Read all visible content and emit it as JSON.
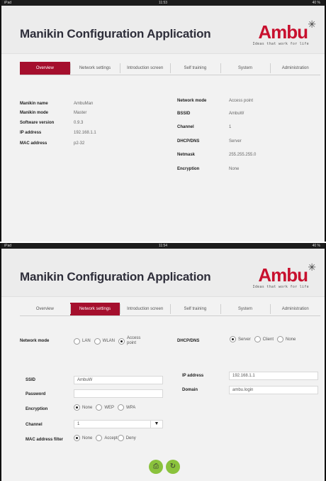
{
  "screen1": {
    "status": {
      "left": "iPad",
      "time": "11:53",
      "right": "40 %"
    },
    "title": "Manikin Configuration Application",
    "logo": {
      "word": "Ambu",
      "tagline": "Ideas that work for life"
    },
    "tabs": [
      "Overview",
      "Network settings",
      "Introduction screen",
      "Self training",
      "System",
      "Administration"
    ],
    "active_tab": 0,
    "left_info": [
      {
        "label": "Manikin name",
        "value": "AmbuMan"
      },
      {
        "label": "Manikin mode",
        "value": "Master"
      },
      {
        "label": "Software version",
        "value": "0.9.3"
      },
      {
        "label": "IP address",
        "value": "192.168.1.1"
      },
      {
        "label": "MAC address",
        "value": "p2-32"
      }
    ],
    "right_info": [
      {
        "label": "Network mode",
        "value": "Access point"
      },
      {
        "label": "BSSID",
        "value": "AmbuW"
      },
      {
        "label": "Channel",
        "value": "1"
      },
      {
        "label": "DHCP/DNS",
        "value": "Server"
      },
      {
        "label": "Netmask",
        "value": "255.255.255.0"
      },
      {
        "label": "Encryption",
        "value": "None"
      }
    ]
  },
  "screen2": {
    "status": {
      "left": "iPad",
      "time": "11:54",
      "right": "40 %"
    },
    "title": "Manikin Configuration Application",
    "logo": {
      "word": "Ambu",
      "tagline": "Ideas that work for life"
    },
    "tabs": [
      "Overview",
      "Network settings",
      "Introduction screen",
      "Self training",
      "System",
      "Administration"
    ],
    "active_tab": 1,
    "network_mode": {
      "label": "Network mode",
      "options": [
        "LAN",
        "WLAN",
        "Access point"
      ],
      "selected": 2
    },
    "dhcp": {
      "label": "DHCP/DNS",
      "options": [
        "Server",
        "Client",
        "None"
      ],
      "selected": 0
    },
    "ssid": {
      "label": "SSID",
      "value": "AmbuW"
    },
    "password": {
      "label": "Password",
      "value": ""
    },
    "encryption": {
      "label": "Encryption",
      "options": [
        "None",
        "WEP",
        "WPA"
      ],
      "selected": 0
    },
    "channel": {
      "label": "Channel",
      "value": "1"
    },
    "mac_filter": {
      "label": "MAC address filter",
      "options": [
        "None",
        "Accept",
        "Deny"
      ],
      "selected": 0
    },
    "ip_address": {
      "label": "IP address",
      "value": "192.168.1.1"
    },
    "domain": {
      "label": "Domain",
      "value": "ambu.login"
    },
    "buttons": {
      "save_icon": "save-icon",
      "refresh_icon": "refresh-icon"
    },
    "accent": "#8ac23c"
  },
  "colors": {
    "tab_active": "#a50f2d",
    "brand": "#c8102e"
  }
}
